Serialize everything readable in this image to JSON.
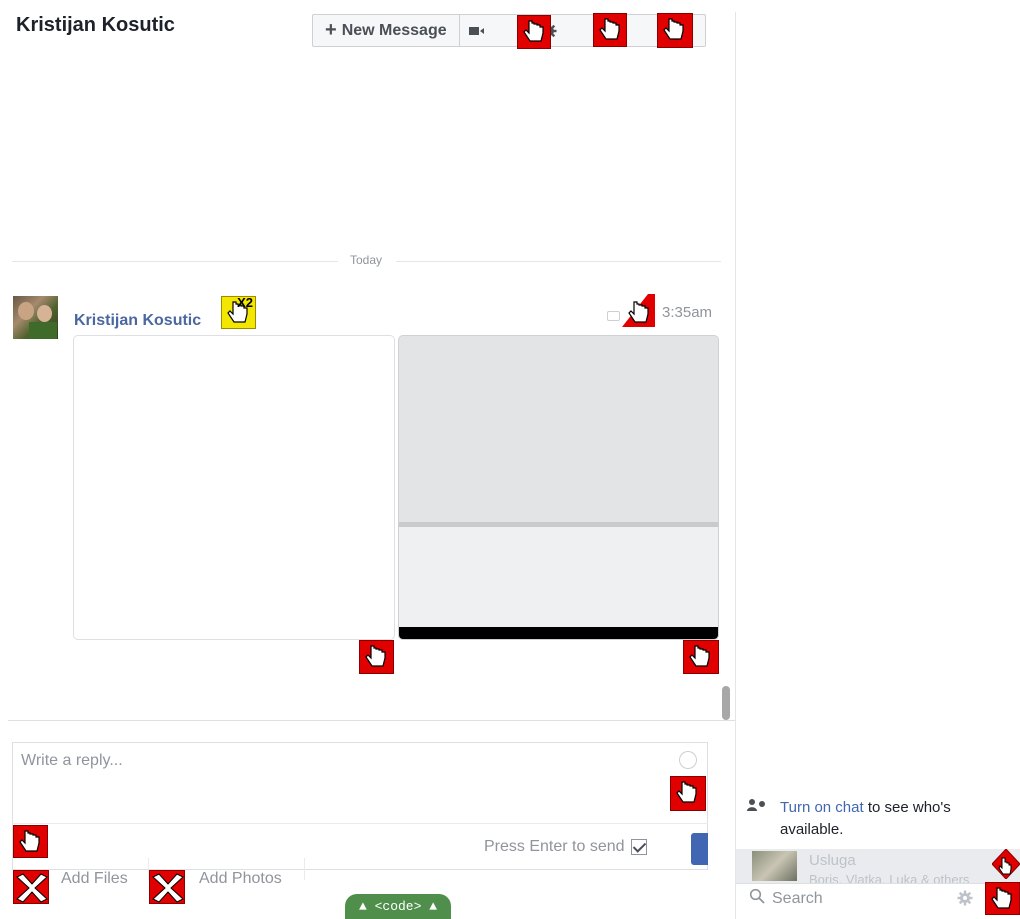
{
  "header": {
    "title": "Kristijan Kosutic",
    "new_message_label": "New Message"
  },
  "timeline": {
    "day_label": "Today",
    "message": {
      "sender": "Kristijan Kosutic",
      "time": "3:35am"
    }
  },
  "composer": {
    "placeholder": "Write a reply...",
    "press_enter_label": "Press Enter to send",
    "add_files_label": "Add Files",
    "add_photos_label": "Add Photos"
  },
  "code_tab": {
    "label": "▲ <code> ▲"
  },
  "chat_sidebar": {
    "turn_on_chat_link": "Turn on chat",
    "turn_on_chat_rest": " to see who's available.",
    "group_name": "Usluga",
    "group_members": "Boris, Vlatka, Luka & others",
    "search_placeholder": "Search"
  },
  "markers": {
    "double_click_label": "X2"
  },
  "colors": {
    "link_blue": "#4b67a1",
    "send_blue": "#4267b2",
    "marker_red": "#e10000",
    "marker_yellow": "#f3e600",
    "code_tab_green": "#4f8f4b"
  }
}
